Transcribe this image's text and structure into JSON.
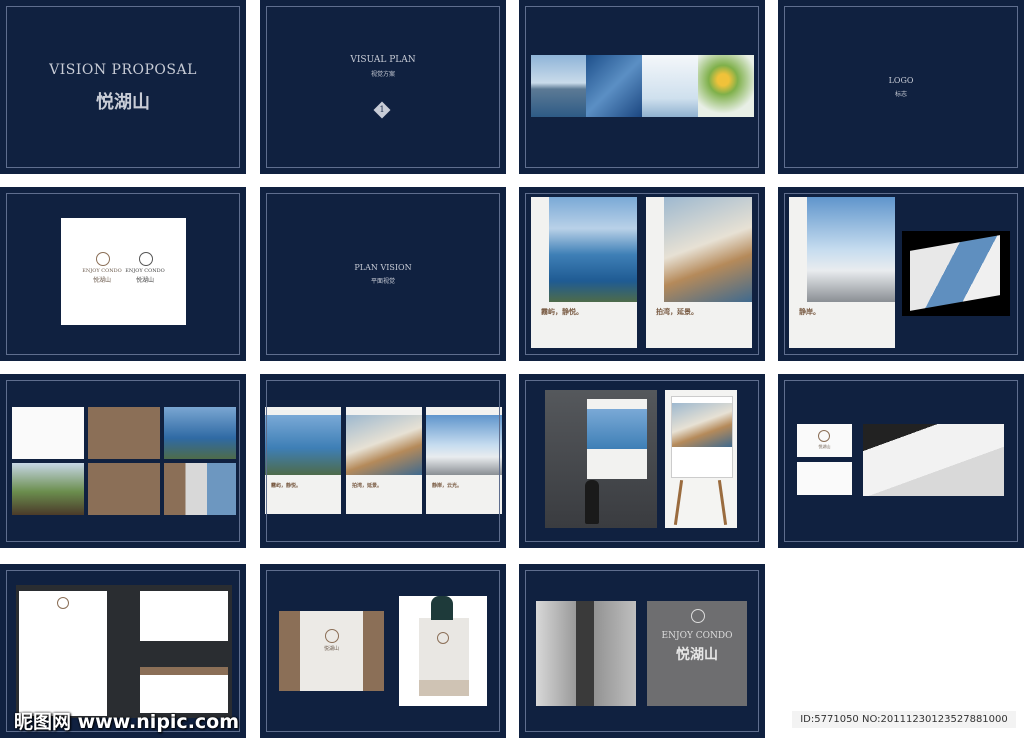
{
  "slides": {
    "s1": {
      "title": "VISION PROPOSAL",
      "subtitle": "悦湖山"
    },
    "s2": {
      "title": "VISUAL PLAN",
      "subtitle": "视觉方案",
      "badge": "1"
    },
    "s4": {
      "title": "LOGO",
      "subtitle": "标志"
    },
    "s5": {
      "logo_en": "ENJOY CONDO",
      "logo_cn": "悦湖山"
    },
    "s6": {
      "title": "PLAN VISION",
      "subtitle": "平面视觉"
    },
    "s7": {
      "poster1": "霧屿，静悦。",
      "poster2": "拍湾，延景。"
    },
    "s8": {
      "poster": "静岸。"
    },
    "s11": {
      "poster1": "霧屿，静悦。",
      "poster2": "拍湾，延景。",
      "poster3": "静岸，云光。"
    },
    "s12": {
      "card": "悦湖山"
    },
    "s14": {
      "logo": "悦湖山"
    },
    "s15": {
      "logo_en": "ENJOY CONDO",
      "logo_cn": "悦湖山"
    }
  },
  "watermark": {
    "site": "昵图网 www.nipic.com",
    "id": "ID:5771050 NO:20111230123527881000"
  },
  "colors": {
    "navy": "#102140",
    "brown": "#8b6f57",
    "frame": "#5f6e8e"
  }
}
